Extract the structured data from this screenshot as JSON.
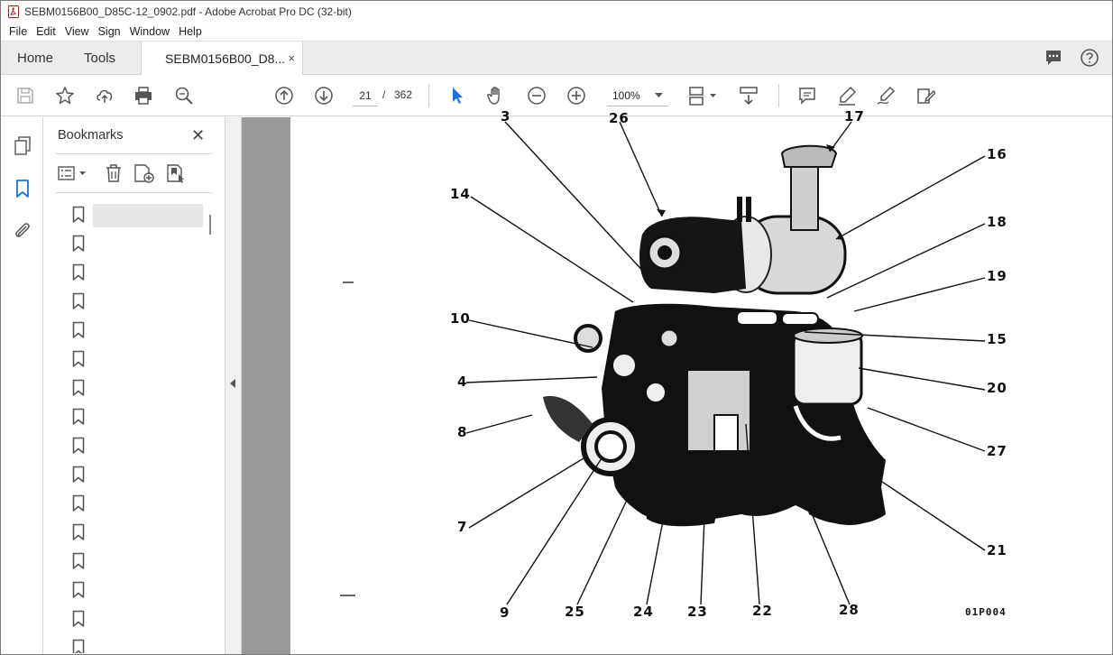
{
  "titlebar": {
    "title": "SEBM0156B00_D85C-12_0902.pdf - Adobe Acrobat Pro DC (32-bit)"
  },
  "menu": [
    "File",
    "Edit",
    "View",
    "Sign",
    "Window",
    "Help"
  ],
  "tabs": {
    "home": "Home",
    "tools": "Tools",
    "document": "SEBM0156B00_D8...",
    "close": "×"
  },
  "toolbar": {
    "page_current": "21",
    "page_separator": "/",
    "page_total": "362",
    "zoom": "100%"
  },
  "bookmarks": {
    "title": "Bookmarks",
    "close": "✕",
    "item_count": 16,
    "selected_index": 0
  },
  "figure": {
    "callouts": [
      "3",
      "26",
      "17",
      "16",
      "14",
      "18",
      "19",
      "10",
      "15",
      "4",
      "20",
      "8",
      "27",
      "7",
      "21",
      "9",
      "25",
      "24",
      "23",
      "22",
      "28"
    ],
    "figure_id": "01P004"
  },
  "colors": {
    "accent": "#1473e6",
    "rail_active": "#1473e6",
    "doc_gray": "#999999"
  }
}
